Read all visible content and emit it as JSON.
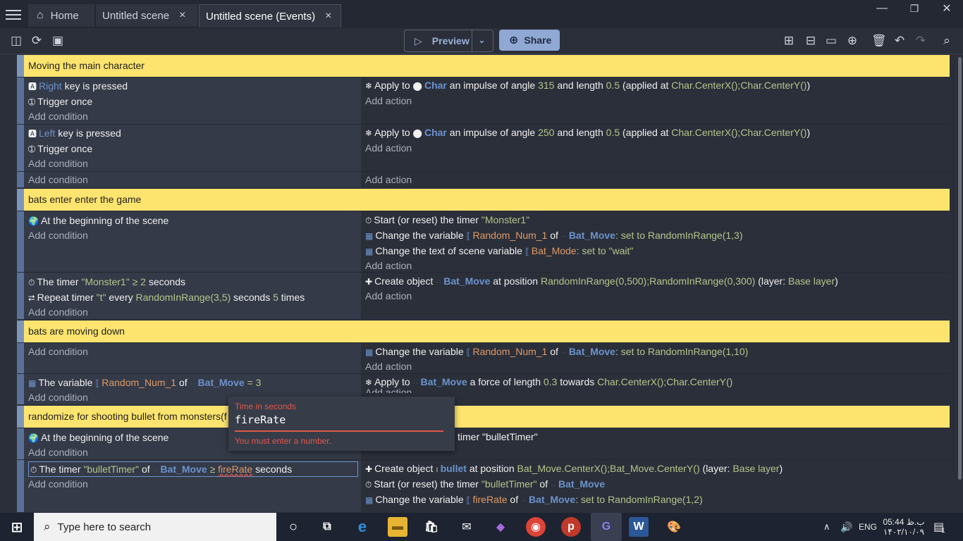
{
  "tabs": {
    "home": "Home",
    "scene": "Untitled scene",
    "events": "Untitled scene (Events)",
    "close": "×"
  },
  "window": {
    "minimize": "—",
    "restore": "❐",
    "close": "✕"
  },
  "toolbar": {
    "preview": "Preview",
    "share": "Share"
  },
  "comments": [
    "Moving the main character",
    "bats enter enter the game",
    "bats are moving down",
    "randomize for shooting bullet from monsters(f"
  ],
  "labels": {
    "add_condition": "Add condition",
    "add_action": "Add action"
  },
  "ev1": {
    "c1_key": "Right",
    "c1_rest": "key is pressed",
    "c2": "Trigger once",
    "a1_pre": "Apply to",
    "a1_obj": "Char",
    "a1_mid": "an impulse of angle",
    "a1_angle": "315",
    "a1_and": "and length",
    "a1_len": "0.5",
    "a1_app": "(applied at",
    "a1_pos": "Char.CenterX();Char.CenterY()",
    "a1_end": ")"
  },
  "ev2": {
    "c1_key": "Left",
    "c1_rest": "key is pressed",
    "c2": "Trigger once",
    "a1_pre": "Apply to",
    "a1_obj": "Char",
    "a1_mid": "an impulse of angle",
    "a1_angle": "250",
    "a1_and": "and length",
    "a1_len": "0.5",
    "a1_app": "(applied at",
    "a1_pos": "Char.CenterX();Char.CenterY()",
    "a1_end": ")"
  },
  "ev4": {
    "c1": "At the beginning of the scene",
    "a1_pre": "Start (or reset) the timer",
    "a1_str": "\"Monster1\"",
    "a2_pre": "Change the variable",
    "a2_var": "Random_Num_1",
    "a2_of": "of",
    "a2_obj": "Bat_Move",
    "a2_set": ": set to",
    "a2_val": "RandomInRange(1,3)",
    "a3_pre": "Change the text of scene variable",
    "a3_var": "Bat_Mode",
    "a3_set": ": set to",
    "a3_val": "\"wait\""
  },
  "ev5": {
    "c1_pre": "The timer",
    "c1_str": "\"Monster1\"",
    "c1_op": "≥",
    "c1_num": "2",
    "c1_unit": "seconds",
    "c2_pre": "Repeat timer",
    "c2_str": "\"t\"",
    "c2_every": "every",
    "c2_range": "RandomInRange(3,5)",
    "c2_sec": "seconds",
    "c2_n": "5",
    "c2_times": "times",
    "a1_pre": "Create object",
    "a1_obj": "Bat_Move",
    "a1_at": "at position",
    "a1_pos": "RandomInRange(0,500);RandomInRange(0,300)",
    "a1_layer": "(layer:",
    "a1_layer_val": "Base layer",
    "a1_end": ")"
  },
  "ev7": {
    "a1_pre": "Change the variable",
    "a1_var": "Random_Num_1",
    "a1_of": "of",
    "a1_obj": "Bat_Move",
    "a1_set": ": set to",
    "a1_val": "RandomInRange(1,10)"
  },
  "ev8": {
    "c1_pre": "The variable",
    "c1_var": "Random_Num_1",
    "c1_of": "of",
    "c1_obj": "Bat_Move",
    "c1_eq": "=",
    "c1_val": "3",
    "a1_pre": "Apply to",
    "a1_obj": "Bat_Move",
    "a1_mid": "a force of length",
    "a1_len": "0.3",
    "a1_tow": "towards",
    "a1_pos": "Char.CenterX();Char.CenterY()"
  },
  "ev10": {
    "c1": "At the beginning of the scene",
    "a1_tail": "timer \"bulletTimer\""
  },
  "ev11": {
    "c1_pre": "The timer",
    "c1_str": "\"bulletTimer\"",
    "c1_of": "of",
    "c1_obj": "Bat_Move",
    "c1_op": "≥",
    "c1_val": "fireRate",
    "c1_unit": "seconds",
    "a1_pre": "Create object",
    "a1_obj": "bullet",
    "a1_at": "at position",
    "a1_pos": "Bat_Move.CenterX();Bat_Move.CenterY()",
    "a1_layer": "(layer:",
    "a1_layer_val": "Base layer",
    "a1_end": ")",
    "a2_pre": "Start (or reset) the timer",
    "a2_str": "\"bulletTimer\"",
    "a2_of": "of",
    "a2_obj": "Bat_Move",
    "a3_pre": "Change the variable",
    "a3_var": "fireRate",
    "a3_of": "of",
    "a3_obj": "Bat_Move",
    "a3_set": ": set to",
    "a3_val": "RandomInRange(1,2)"
  },
  "popup": {
    "label": "Time in seconds",
    "value": "fireRate",
    "error": "You must enter a number."
  },
  "taskbar": {
    "search_placeholder": "Type here to search",
    "lang": "ENG",
    "time": "05:44 ب.ظ",
    "date": "۱۴۰۲/۱۰/۰۹",
    "notif_count": "1"
  }
}
